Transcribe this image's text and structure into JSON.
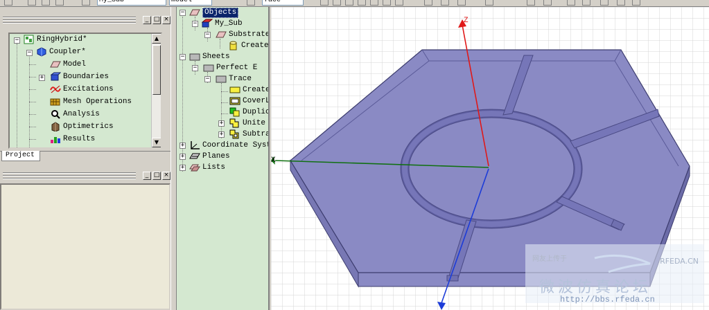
{
  "toolbar": {
    "material_field": "My_Sub",
    "model_field": "model",
    "face_field": "face"
  },
  "project_panel": {
    "tab_label": "Project",
    "items": [
      {
        "label": "RingHybrid*",
        "icon": "project-icon"
      },
      {
        "label": "Coupler*",
        "icon": "design-icon"
      },
      {
        "label": "Model",
        "icon": "model-icon"
      },
      {
        "label": "Boundaries",
        "icon": "boundaries-icon"
      },
      {
        "label": "Excitations",
        "icon": "excitations-icon"
      },
      {
        "label": "Mesh Operations",
        "icon": "mesh-operations-icon"
      },
      {
        "label": "Analysis",
        "icon": "analysis-icon"
      },
      {
        "label": "Optimetrics",
        "icon": "optimetrics-icon"
      },
      {
        "label": "Results",
        "icon": "results-icon"
      }
    ]
  },
  "window_buttons": {
    "minimize": "_",
    "restore": "□",
    "close": "×"
  },
  "model_tree": {
    "items": [
      {
        "label": "Objects"
      },
      {
        "label": "My_Sub"
      },
      {
        "label": "Substrate"
      },
      {
        "label": "Create"
      },
      {
        "label": "Sheets"
      },
      {
        "label": "Perfect E"
      },
      {
        "label": "Trace"
      },
      {
        "label": "Create"
      },
      {
        "label": "CoverL"
      },
      {
        "label": "Duplic"
      },
      {
        "label": "Unite"
      },
      {
        "label": "Subtra"
      },
      {
        "label": "Coordinate Syst"
      },
      {
        "label": "Planes"
      },
      {
        "label": "Lists"
      }
    ]
  },
  "viewport": {
    "axis_z": "Z",
    "axis_x": "X",
    "colors": {
      "substrate_fill": "#8a8ac4",
      "substrate_edge": "#3c3c6e",
      "z_axis": "#e01818",
      "x_axis": "#107010",
      "y_axis": "#1c3cd8",
      "grid": "#d0d0d0"
    }
  },
  "watermark": {
    "small": "网友上传于",
    "brand": "RFEDA.CN",
    "chinese": "微波仿真论坛",
    "url": "http://bbs.rfeda.cn"
  }
}
